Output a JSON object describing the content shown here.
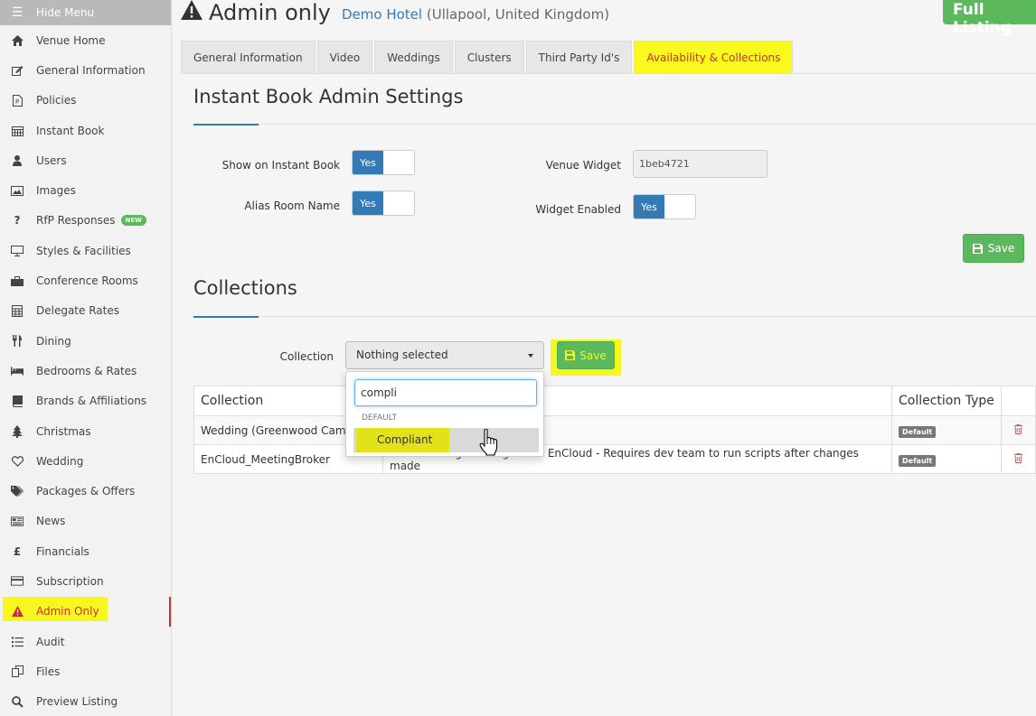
{
  "sidebar": {
    "hide_menu": "Hide Menu",
    "items": [
      {
        "label": "Venue Home",
        "icon": "home-icon"
      },
      {
        "label": "General Information",
        "icon": "edit-icon"
      },
      {
        "label": "Policies",
        "icon": "document-icon"
      },
      {
        "label": "Instant Book",
        "icon": "calendar-icon"
      },
      {
        "label": "Users",
        "icon": "user-icon"
      },
      {
        "label": "Images",
        "icon": "image-icon"
      },
      {
        "label": "RfP Responses",
        "icon": "question-icon",
        "badge": "NEW"
      },
      {
        "label": "Styles & Facilities",
        "icon": "monitor-icon"
      },
      {
        "label": "Conference Rooms",
        "icon": "briefcase-icon"
      },
      {
        "label": "Delegate Rates",
        "icon": "calculator-icon"
      },
      {
        "label": "Dining",
        "icon": "cutlery-icon"
      },
      {
        "label": "Bedrooms & Rates",
        "icon": "bed-icon"
      },
      {
        "label": "Brands & Affiliations",
        "icon": "book-icon"
      },
      {
        "label": "Christmas",
        "icon": "tree-icon"
      },
      {
        "label": "Wedding",
        "icon": "heart-icon"
      },
      {
        "label": "Packages & Offers",
        "icon": "tags-icon"
      },
      {
        "label": "News",
        "icon": "newspaper-icon"
      },
      {
        "label": "Financials",
        "icon": "pound-icon"
      },
      {
        "label": "Subscription",
        "icon": "credit-card-icon"
      },
      {
        "label": "Admin Only",
        "icon": "warning-icon",
        "active": true
      },
      {
        "label": "Audit",
        "icon": "list-icon"
      },
      {
        "label": "Files",
        "icon": "files-icon"
      },
      {
        "label": "Preview Listing",
        "icon": "search-icon"
      }
    ]
  },
  "header": {
    "title": "Admin only",
    "hotel_name": "Demo Hotel",
    "hotel_location": "(Ullapool, United Kingdom)",
    "full_listing": "Full Listing"
  },
  "tabs": [
    {
      "label": "General Information"
    },
    {
      "label": "Video"
    },
    {
      "label": "Weddings"
    },
    {
      "label": "Clusters"
    },
    {
      "label": "Third Party Id's"
    },
    {
      "label": "Availability & Collections",
      "active": true
    }
  ],
  "instant_book": {
    "title": "Instant Book Admin Settings",
    "show_on_instant_book_label": "Show on Instant Book",
    "show_on_instant_book_value": "Yes",
    "alias_room_name_label": "Alias Room Name",
    "alias_room_name_value": "Yes",
    "venue_widget_label": "Venue Widget",
    "venue_widget_value": "1beb4721",
    "widget_enabled_label": "Widget Enabled",
    "widget_enabled_value": "Yes",
    "save_label": "Save"
  },
  "collections": {
    "title": "Collections",
    "collection_label": "Collection",
    "select_value": "Nothing selected",
    "save_label": "Save",
    "table": {
      "headers": [
        "Collection",
        "",
        "Collection Type",
        ""
      ],
      "rows": [
        {
          "name": "Wedding (Greenwood Campbell",
          "description": "",
          "type": "Default"
        },
        {
          "name": "EnCloud_MeetingBroker",
          "description": "Venues using MeetingBroker EnCloud - Requires dev team to run scripts after changes made",
          "type": "Default"
        }
      ]
    },
    "dropdown": {
      "search_value": "compli",
      "group_header": "DEFAULT",
      "option": "Compliant"
    }
  },
  "colors": {
    "accent_blue": "#337ab7",
    "success_green": "#5cb85c",
    "highlight_yellow": "#f7f720",
    "danger_red": "#c9302c"
  }
}
